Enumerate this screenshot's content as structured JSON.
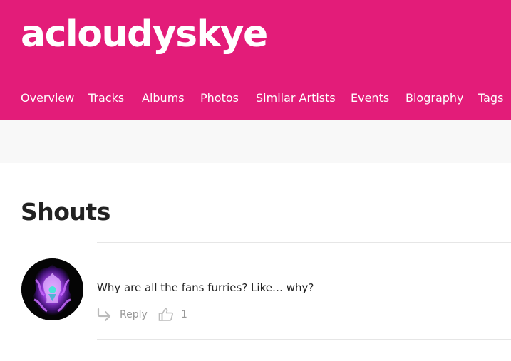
{
  "header": {
    "artist_name": "acloudyskye",
    "brand_color": "#e31c79",
    "nav": [
      "Overview",
      "Tracks",
      "Albums",
      "Photos",
      "Similar Artists",
      "Events",
      "Biography",
      "Tags"
    ]
  },
  "shouts": {
    "title": "Shouts",
    "items": [
      {
        "avatar_icon": "user-avatar",
        "text": "Why are all the fans furries? Like… why?",
        "reply_icon": "reply-arrow-icon",
        "reply_label": "Reply",
        "like_icon": "thumbs-up-icon",
        "like_count": "1"
      }
    ]
  }
}
